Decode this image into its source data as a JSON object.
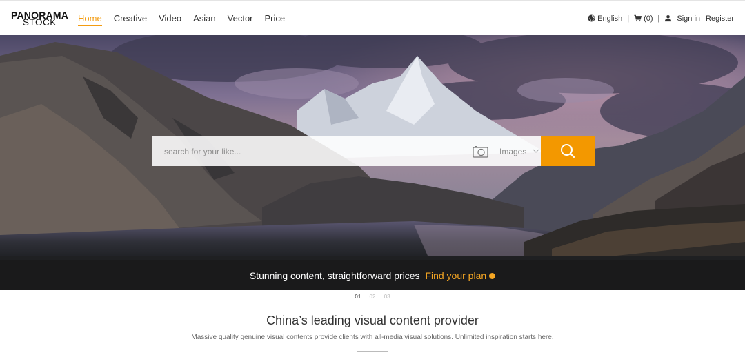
{
  "logo": {
    "line1": "PANORAMA",
    "line2": "STOCK"
  },
  "nav": {
    "items": [
      {
        "label": "Home",
        "active": true
      },
      {
        "label": "Creative",
        "active": false
      },
      {
        "label": "Video",
        "active": false
      },
      {
        "label": "Asian",
        "active": false
      },
      {
        "label": "Vector",
        "active": false
      },
      {
        "label": "Price",
        "active": false
      }
    ]
  },
  "utility": {
    "language": "English",
    "cart": "(0)",
    "separator": "|",
    "sign_in": "Sign in",
    "register": "Register"
  },
  "search": {
    "placeholder": "search for your like...",
    "value": "",
    "type_selected": "Images",
    "button_icon": "search-icon",
    "camera_icon": "camera-icon"
  },
  "promo": {
    "text": "Stunning content, straightforward prices",
    "link": "Find your plan"
  },
  "pager": {
    "items": [
      "01",
      "02",
      "03"
    ],
    "active_index": 0
  },
  "intro": {
    "title": "China’s leading visual content provider",
    "subtitle": "Massive quality genuine visual contents provide clients with all-media visual solutions. Unlimited inspiration starts here."
  },
  "colors": {
    "accent": "#f39800",
    "accent_text": "#f5a623",
    "text": "#333333"
  }
}
